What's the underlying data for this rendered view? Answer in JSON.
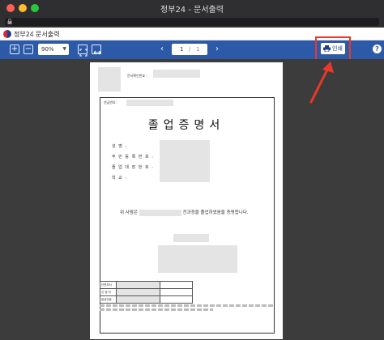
{
  "window": {
    "title": "정부24 - 문서출력"
  },
  "app_header": {
    "app_name": "정부24",
    "separator": "|",
    "doc_name": "문서출력"
  },
  "toolbar": {
    "zoom_in": "+",
    "zoom_out": "−",
    "zoom_value": "90%",
    "zoom_caret": "▼",
    "prev": "‹",
    "next": "›",
    "page_current": "1",
    "page_separator": "/",
    "page_total": "1",
    "print_label": "인쇄",
    "help_label": "?"
  },
  "highlight_color": "#e8392b",
  "document": {
    "issue_number_label": "문서확인번호 :",
    "register_label": "연급번호 :",
    "title": "졸업증명서",
    "fields": [
      {
        "label": "성          명 :"
      },
      {
        "label": "주 민 등 록 번 호 :"
      },
      {
        "label": "졸 업 대 장 번 호 :"
      },
      {
        "label": "학          교 :"
      }
    ],
    "body_prefix": "위 사람은",
    "body_suffix": "전과정을 졸업하였음을 증명합니다.",
    "sig_rows": [
      "단변부서",
      "신 청 자",
      "발급번호"
    ]
  }
}
